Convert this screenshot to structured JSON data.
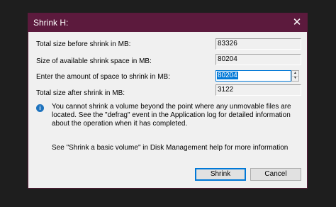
{
  "dialog": {
    "title": "Shrink H:",
    "close_symbol": "✕"
  },
  "fields": {
    "total_before_label": "Total size before shrink in MB:",
    "total_before_value": "83326",
    "available_label": "Size of available shrink space in MB:",
    "available_value": "80204",
    "amount_label": "Enter the amount of space to shrink in MB:",
    "amount_value": "80204",
    "total_after_label": "Total size after shrink in MB:",
    "total_after_value": "3122"
  },
  "info": {
    "icon": "info-icon",
    "icon_glyph": "i",
    "text": "You cannot shrink a volume beyond the point where any unmovable files are located. See the \"defrag\" event in the Application log for detailed information about the operation when it has completed.",
    "help_text": "See \"Shrink a basic volume\" in Disk Management help for more information"
  },
  "buttons": {
    "shrink_label": "Shrink",
    "cancel_label": "Cancel"
  },
  "colors": {
    "titlebar": "#5c1a3d",
    "accent": "#0078d7",
    "dialog_bg": "#f0f0f0",
    "backdrop": "#1e1e1e"
  }
}
